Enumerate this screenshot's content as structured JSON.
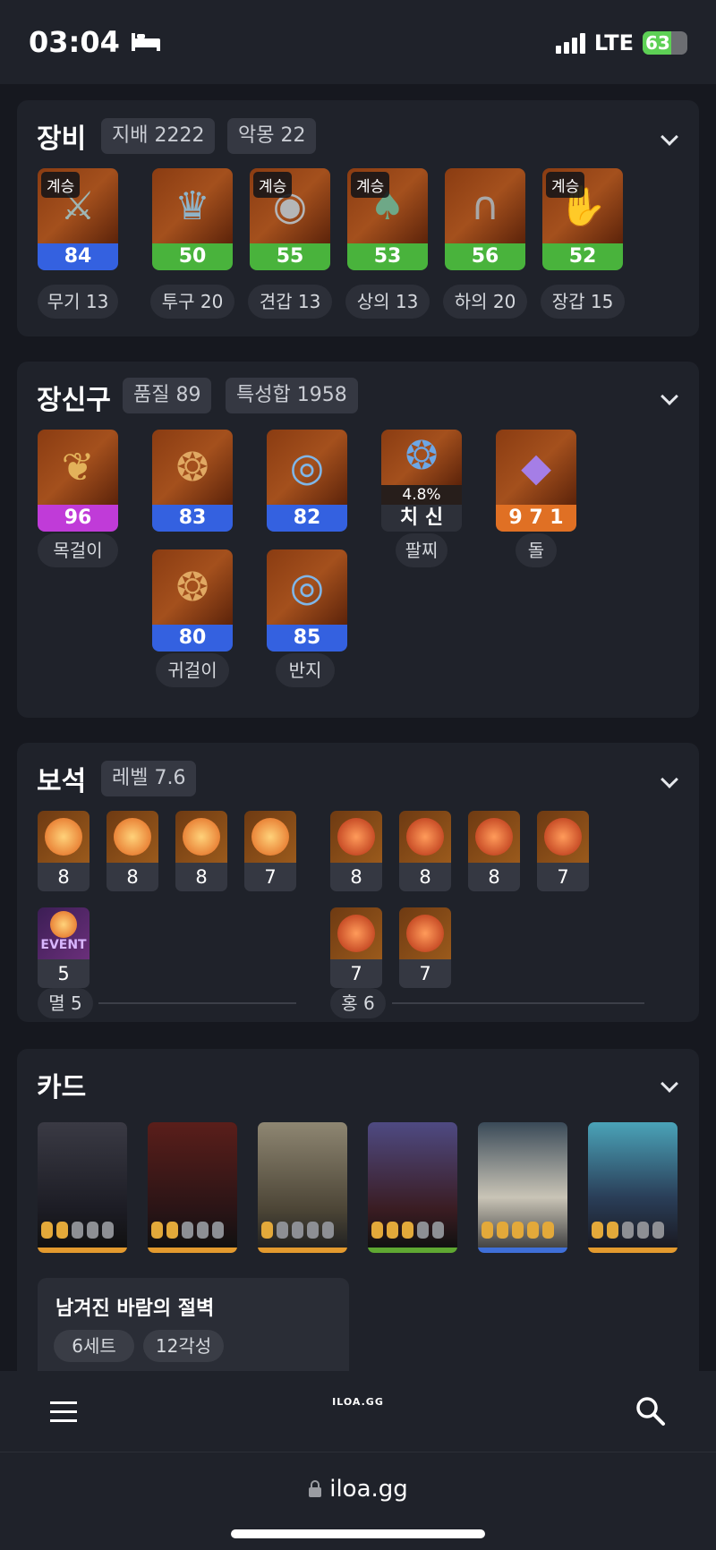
{
  "status_bar": {
    "time": "03:04",
    "network": "LTE",
    "battery": "63",
    "battery_level": 0.63
  },
  "equipment": {
    "title": "장비",
    "chips": [
      "지배 2222",
      "악몽 22"
    ],
    "items": [
      {
        "badge": "계승",
        "value": "84",
        "color": "blue",
        "label": "무기 13",
        "icon": "weapon-icon"
      },
      {
        "badge": "",
        "value": "50",
        "color": "green",
        "label": "투구 20",
        "icon": "helmet-icon"
      },
      {
        "badge": "계승",
        "value": "55",
        "color": "green",
        "label": "견갑 13",
        "icon": "shoulder-icon"
      },
      {
        "badge": "계승",
        "value": "53",
        "color": "green",
        "label": "상의 13",
        "icon": "chest-icon"
      },
      {
        "badge": "",
        "value": "56",
        "color": "green",
        "label": "하의 20",
        "icon": "pants-icon"
      },
      {
        "badge": "계승",
        "value": "52",
        "color": "green",
        "label": "장갑 15",
        "icon": "gloves-icon"
      }
    ]
  },
  "accessories": {
    "title": "장신구",
    "chips": [
      "품질 89",
      "특성합 1958"
    ],
    "necklace": {
      "value": "96",
      "label": "목걸이"
    },
    "earrings": {
      "values": [
        "83",
        "80"
      ],
      "label": "귀걸이"
    },
    "rings": {
      "values": [
        "82",
        "85"
      ],
      "label": "반지"
    },
    "bracelet": {
      "percent": "4.8%",
      "text": "치 신",
      "label": "팔찌"
    },
    "stone": {
      "value": "9 7 1",
      "label": "돌"
    }
  },
  "gems": {
    "title": "보석",
    "chip": "레벨 7.6",
    "left_levels": [
      "8",
      "8",
      "8",
      "7",
      "5"
    ],
    "event_label": "EVENT",
    "left_summary": "멸 5",
    "right_levels": [
      "8",
      "8",
      "8",
      "7",
      "7",
      "7"
    ],
    "right_summary": "홍 6"
  },
  "cards": {
    "title": "카드",
    "awakening": [
      2,
      2,
      1,
      3,
      5,
      2
    ],
    "set_name": "남겨진 바람의 절벽",
    "set_chips": [
      "6세트",
      "12각성"
    ]
  },
  "bottom_nav": {
    "logo": "ILOA.GG"
  },
  "url_bar": {
    "url": "iloa.gg"
  }
}
